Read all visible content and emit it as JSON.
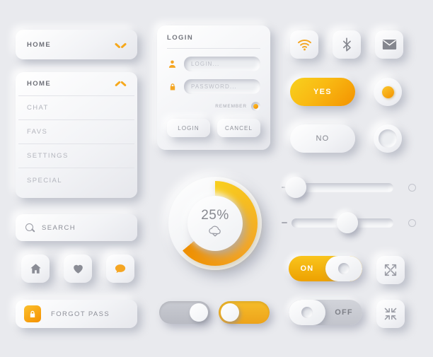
{
  "theme": {
    "background": "#e9eaee",
    "accent_orange": "#f5a623",
    "accent_gradient_start": "#f8d11e",
    "accent_gradient_end": "#f39200",
    "text_gray": "#8d8f98",
    "text_dark": "#6e7078"
  },
  "dropdown_collapsed": {
    "label": "HOME",
    "chevron": "chevron-down-icon"
  },
  "dropdown_expanded": {
    "header": "HOME",
    "chevron": "chevron-up-icon",
    "items": [
      {
        "label": "CHAT"
      },
      {
        "label": "FAVS"
      },
      {
        "label": "SETTINGS"
      },
      {
        "label": "SPECIAL"
      }
    ]
  },
  "search": {
    "icon": "search-icon",
    "placeholder": "SEARCH",
    "value": "SEARCH"
  },
  "icon_buttons": [
    {
      "name": "home-icon",
      "label": "HOME",
      "color": "#8a8c95"
    },
    {
      "name": "heart-icon",
      "label": "FAVORITE",
      "color": "#8a8c95"
    },
    {
      "name": "chat-bubble-icon",
      "label": "CHAT",
      "color": "#f5a623"
    }
  ],
  "forgot_pass": {
    "label": "FORGOT PASS",
    "icon": "lock-icon"
  },
  "login_card": {
    "title": "LOGIN",
    "username": {
      "icon": "user-icon",
      "placeholder": "LOGIN...",
      "value": ""
    },
    "password": {
      "icon": "lock-icon",
      "placeholder": "PASSWORD...",
      "value": ""
    },
    "remember": {
      "label": "REMEMBER",
      "checked": true
    },
    "submit_label": "LOGIN",
    "cancel_label": "CANCEL"
  },
  "tiles": [
    {
      "name": "wifi-icon",
      "label": "WIFI",
      "color": "#f5a623"
    },
    {
      "name": "bluetooth-icon",
      "label": "BLUETOOTH",
      "color": "#85878f"
    },
    {
      "name": "mail-icon",
      "label": "MAIL",
      "color": "#85878f"
    }
  ],
  "confirm": {
    "yes_label": "YES",
    "no_label": "NO"
  },
  "radios": [
    {
      "name": "radio-selected",
      "checked": true
    },
    {
      "name": "radio-unselected",
      "checked": false
    }
  ],
  "sliders": [
    {
      "name": "slider-empty",
      "value": 4,
      "min": 0,
      "max": 100,
      "filled": false,
      "minus": "minus-icon",
      "end": "circle-icon"
    },
    {
      "name": "slider-filled",
      "value": 55,
      "min": 0,
      "max": 100,
      "filled": true,
      "minus": "minus-icon",
      "end": "circle-icon"
    }
  ],
  "progress_ring": {
    "percent_label": "25%",
    "percent": 25,
    "arc_sweep_deg": 230,
    "icon": "cloud-download-icon",
    "arc_color": "#f5a623"
  },
  "toggles_plain": [
    {
      "name": "toggle-gray-on",
      "state": "right",
      "color": "#c4c6cd"
    },
    {
      "name": "toggle-orange-off",
      "state": "left",
      "color": "#f0ad20"
    }
  ],
  "toggles_labeled": [
    {
      "name": "toggle-on",
      "label": "ON",
      "state": "on"
    },
    {
      "name": "toggle-off",
      "label": "OFF",
      "state": "off"
    }
  ],
  "expand_tiles": [
    {
      "name": "expand-icon",
      "label": "EXPAND"
    },
    {
      "name": "collapse-icon",
      "label": "COLLAPSE"
    }
  ]
}
